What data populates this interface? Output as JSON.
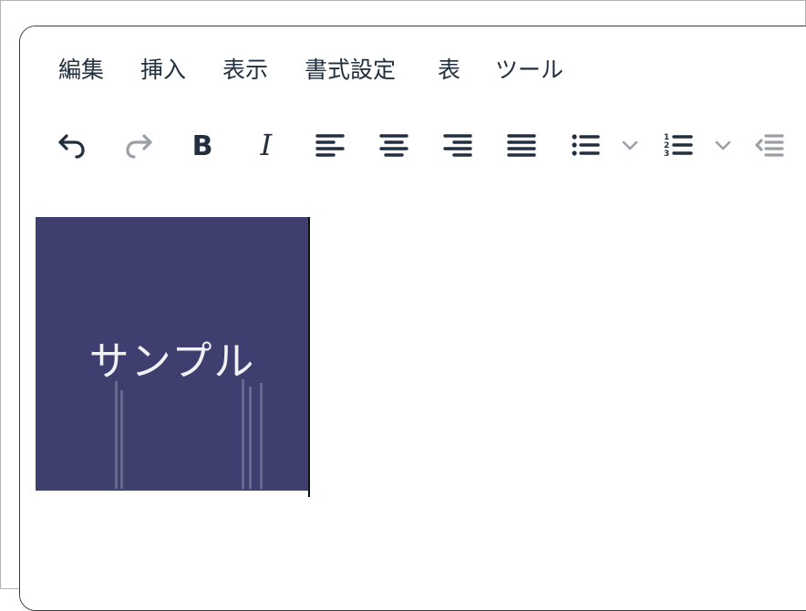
{
  "menubar": {
    "items": [
      "編集",
      "挿入",
      "表示",
      "書式設定",
      "表",
      "ツール"
    ]
  },
  "toolbar": {
    "buttons": [
      {
        "name": "undo-icon",
        "enabled": true
      },
      {
        "name": "redo-icon",
        "enabled": false
      },
      {
        "name": "bold-icon",
        "enabled": true
      },
      {
        "name": "italic-icon",
        "enabled": true
      },
      {
        "name": "align-left-icon",
        "enabled": true
      },
      {
        "name": "align-center-icon",
        "enabled": true
      },
      {
        "name": "align-right-icon",
        "enabled": true
      },
      {
        "name": "align-justify-icon",
        "enabled": true
      },
      {
        "name": "bullet-list-icon",
        "enabled": true
      },
      {
        "name": "numbered-list-icon",
        "enabled": true
      },
      {
        "name": "outdent-icon",
        "enabled": false
      }
    ]
  },
  "content": {
    "image_text": "サンプル",
    "image_background": "#3f3f6f"
  },
  "colors": {
    "icon": "#222f3e",
    "icon_disabled": "#9aa0a6",
    "border": "#3a3a3a"
  }
}
